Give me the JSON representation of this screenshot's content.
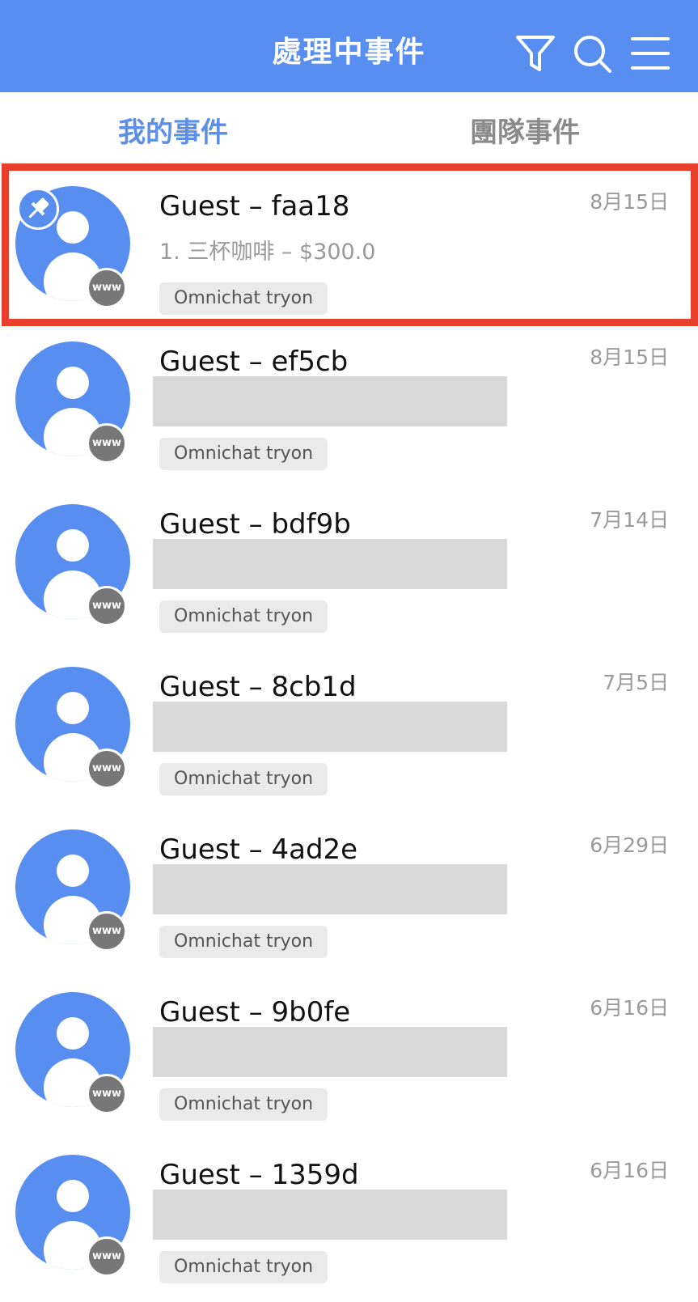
{
  "header": {
    "title": "處理中事件",
    "background_color": "#578ef0",
    "icons": [
      "filter-icon",
      "search-icon",
      "menu-icon"
    ]
  },
  "tabs": [
    {
      "label": "我的事件",
      "active": true
    },
    {
      "label": "團隊事件",
      "active": false
    }
  ],
  "items": [
    {
      "name": "Guest – faa18",
      "date": "8月15日",
      "preview": "1. 三杯咖啡 – $300.0",
      "tag": "Omnichat tryon",
      "channel": "www",
      "pinned": true,
      "highlighted": true
    },
    {
      "name": "Guest – ef5cb",
      "date": "8月15日",
      "preview": "",
      "tag": "Omnichat tryon",
      "channel": "www",
      "pinned": false,
      "highlighted": false
    },
    {
      "name": "Guest – bdf9b",
      "date": "7月14日",
      "preview": "",
      "tag": "Omnichat tryon",
      "channel": "www",
      "pinned": false,
      "highlighted": false
    },
    {
      "name": "Guest – 8cb1d",
      "date": "7月5日",
      "preview": "",
      "tag": "Omnichat tryon",
      "channel": "www",
      "pinned": false,
      "highlighted": false
    },
    {
      "name": "Guest – 4ad2e",
      "date": "6月29日",
      "preview": "",
      "tag": "Omnichat tryon",
      "channel": "www",
      "pinned": false,
      "highlighted": false
    },
    {
      "name": "Guest – 9b0fe",
      "date": "6月16日",
      "preview": "",
      "tag": "Omnichat tryon",
      "channel": "www",
      "pinned": false,
      "highlighted": false
    },
    {
      "name": "Guest – 1359d",
      "date": "6月16日",
      "preview": "",
      "tag": "Omnichat tryon",
      "channel": "www",
      "pinned": false,
      "highlighted": false
    }
  ],
  "colors": {
    "accent": "#578ef0",
    "highlight_border": "#e8402c",
    "redaction": "#d8d8d8"
  }
}
